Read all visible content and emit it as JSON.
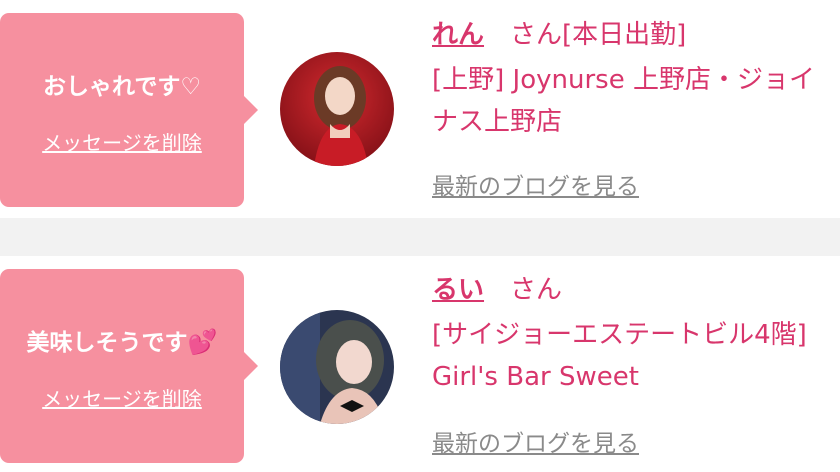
{
  "items": [
    {
      "message": "おしゃれです♡",
      "message_emoji": "",
      "delete_label": "メッセージを削除",
      "name": "れん",
      "suffix": "さん[本日出勤]",
      "shop": "[上野] Joynurse 上野店・ジョイナス上野店",
      "blog_label": "最新のブログを見る"
    },
    {
      "message": "美味しそうです",
      "message_emoji": "💕",
      "delete_label": "メッセージを削除",
      "name": "るい",
      "suffix": "さん",
      "shop": "[サイジョーエステートビル4階] Girl's Bar Sweet",
      "blog_label": "最新のブログを見る"
    }
  ],
  "colors": {
    "bubble": "#f6909f",
    "accent": "#d8366c",
    "muted": "#8a8a8a",
    "divider": "#f2f2f2"
  }
}
